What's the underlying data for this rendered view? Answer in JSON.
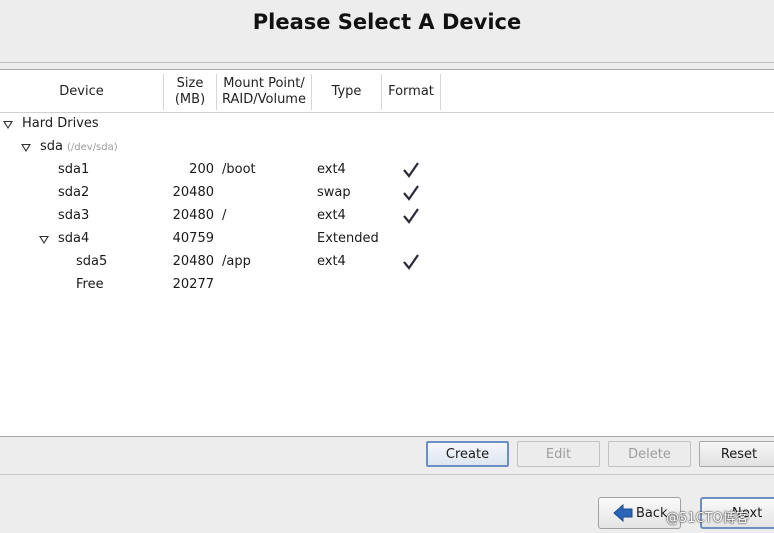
{
  "window": {
    "title": "Please Select A Device"
  },
  "table": {
    "headers": {
      "device": "Device",
      "size_line1": "Size",
      "size_line2": "(MB)",
      "mount_line1": "Mount Point/",
      "mount_line2": "RAID/Volume",
      "type": "Type",
      "format": "Format"
    },
    "rows": [
      {
        "device": "Hard Drives",
        "size": "",
        "mount": "",
        "type": "",
        "format": false,
        "expander": true
      },
      {
        "device": "sda",
        "sub": "(/dev/sda)",
        "size": "",
        "mount": "",
        "type": "",
        "format": false,
        "expander": true
      },
      {
        "device": "sda1",
        "size": "200",
        "mount": "/boot",
        "type": "ext4",
        "format": true
      },
      {
        "device": "sda2",
        "size": "20480",
        "mount": "",
        "type": "swap",
        "format": true
      },
      {
        "device": "sda3",
        "size": "20480",
        "mount": "/",
        "type": "ext4",
        "format": true
      },
      {
        "device": "sda4",
        "size": "40759",
        "mount": "",
        "type": "Extended",
        "format": false,
        "expander": true
      },
      {
        "device": "sda5",
        "size": "20480",
        "mount": "/app",
        "type": "ext4",
        "format": true
      },
      {
        "device": "Free",
        "size": "20277",
        "mount": "",
        "type": "",
        "format": false
      }
    ]
  },
  "actions": {
    "create": "Create",
    "edit": "Edit",
    "delete": "Delete",
    "reset": "Reset"
  },
  "nav": {
    "back": "Back",
    "next": "Next"
  },
  "watermark": "@51CTO博客",
  "icons": {
    "expander": "triangle-down-icon",
    "check": "checkmark-icon",
    "back": "arrow-left-icon",
    "next": "arrow-right-icon"
  },
  "colors": {
    "focus_border": "#6c8fc2",
    "back_arrow": "#2a64b8"
  }
}
